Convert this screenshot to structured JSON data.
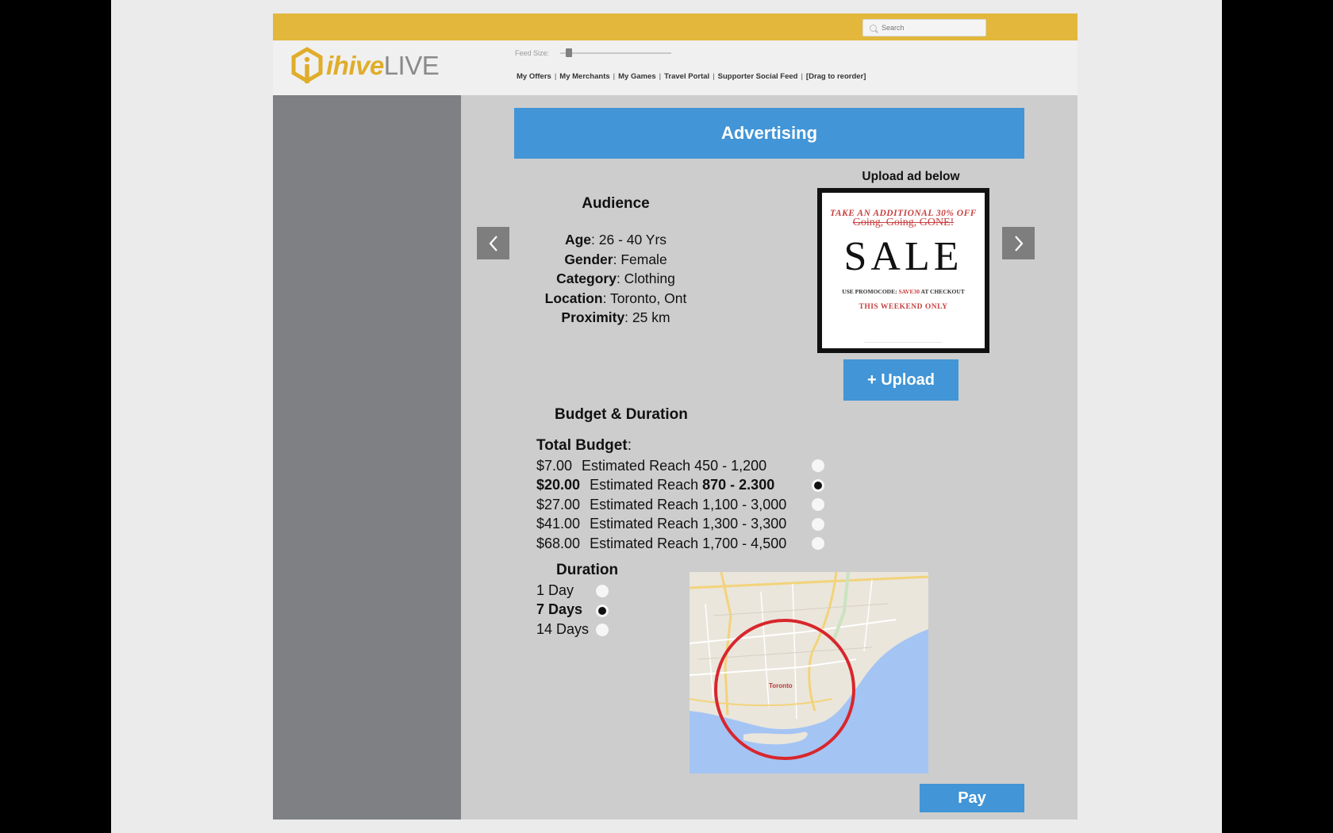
{
  "search": {
    "placeholder": "Search"
  },
  "logo": {
    "part1": "ihive",
    "part2": "LIVE"
  },
  "feed_size": {
    "label": "Feed Size:",
    "value_fraction": 0.05
  },
  "nav": {
    "items": [
      "My Offers",
      "My Merchants",
      "My Games",
      "Travel Portal",
      "Supporter Social Feed",
      "[Drag to reorder]"
    ],
    "separator": "|"
  },
  "banner": {
    "title": "Advertising"
  },
  "audience": {
    "title": "Audience",
    "rows": [
      {
        "label": "Age",
        "value": ": 26 - 40 Yrs"
      },
      {
        "label": "Gender",
        "value": ": Female"
      },
      {
        "label": "Category",
        "value": ": Clothing"
      },
      {
        "label": "Location",
        "value": ": Toronto, Ont"
      },
      {
        "label": "Proximity",
        "value": ": 25 km"
      }
    ]
  },
  "upload": {
    "title": "Upload ad below",
    "button": "+ Upload"
  },
  "ad": {
    "top": "TAKE AN ADDITIONAL 30% OFF",
    "strike": "Going, Going, GONE!",
    "headline": "SALE",
    "promo_prefix": "USE PROMOCODE:",
    "promo_code": "SAVE30",
    "promo_suffix": "AT CHECKOUT",
    "weekend": "THIS WEEKEND ONLY"
  },
  "budget": {
    "title": "Budget & Duration",
    "total_label": "Total Budget",
    "total_colon": ":",
    "reach_label": "Estimated Reach",
    "options": [
      {
        "price": "$7.00",
        "reach": "450 - 1,200",
        "selected": false
      },
      {
        "price": "$20.00",
        "reach": "870 - 2.300",
        "selected": true
      },
      {
        "price": "$27.00",
        "reach": "1,100 - 3,000",
        "selected": false
      },
      {
        "price": "$41.00",
        "reach": "1,300 - 3,300",
        "selected": false
      },
      {
        "price": "$68.00",
        "reach": "1,700 - 4,500",
        "selected": false
      }
    ]
  },
  "duration": {
    "title": "Duration",
    "options": [
      {
        "label": "1 Day",
        "selected": false
      },
      {
        "label": "7 Days",
        "selected": true
      },
      {
        "label": "14 Days",
        "selected": false
      }
    ]
  },
  "map": {
    "city_label": "Toronto"
  },
  "pay": {
    "label": "Pay"
  },
  "colors": {
    "accent_blue": "#4295d6",
    "topbar_yellow": "#e2b73c",
    "sidebar_gray": "#7f8083",
    "map_circle_red": "#d8262c"
  }
}
